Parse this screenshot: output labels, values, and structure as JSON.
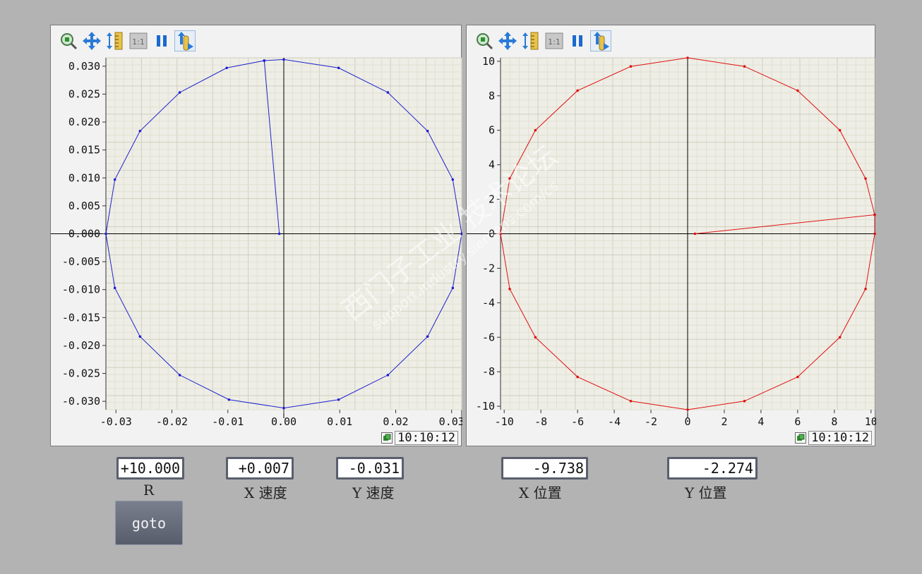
{
  "toolbar": {
    "icons": [
      "zoom-icon",
      "pan-icon",
      "ruler-icon",
      "zoom-1to1-icon",
      "pause-icon",
      "scroll-icon"
    ],
    "one_to_one_label": "1:1"
  },
  "left_chart": {
    "clock_time": "10:10:12",
    "y_tick_labels": [
      "0.030",
      "0.025",
      "0.020",
      "0.015",
      "0.010",
      "0.005",
      "0.000",
      "-0.005",
      "-0.010",
      "-0.015",
      "-0.020",
      "-0.025",
      "-0.030"
    ],
    "x_tick_labels": [
      "-0.03",
      "-0.02",
      "-0.01",
      "0.00",
      "0.01",
      "0.02",
      "0.03"
    ],
    "color": "#1f1fd0"
  },
  "right_chart": {
    "clock_time": "10:10:12",
    "y_tick_labels": [
      "10",
      "8",
      "6",
      "4",
      "2",
      "0",
      "-2",
      "-4",
      "-6",
      "-8",
      "-10"
    ],
    "x_tick_labels": [
      "-10",
      "-8",
      "-6",
      "-4",
      "-2",
      "0",
      "2",
      "4",
      "6",
      "8",
      "10"
    ],
    "color": "#e01010"
  },
  "chart_data": [
    {
      "type": "line",
      "title": "",
      "xlabel": "",
      "ylabel": "",
      "xlim": [
        -0.0318,
        0.0318
      ],
      "ylim": [
        -0.0315,
        0.0315
      ],
      "grid": true,
      "series": [
        {
          "x": [
            -0.0008,
            -0.0035,
            -0.0102,
            -0.0186,
            -0.0257,
            -0.0302,
            -0.0318,
            -0.0302,
            -0.0257,
            -0.0186,
            -0.0098,
            0.0,
            0.0098,
            0.0186,
            0.0257,
            0.0302,
            0.0318,
            0.0302,
            0.0257,
            0.0186,
            0.0098,
            0.0,
            -0.0035
          ],
          "y": [
            0.0,
            0.031,
            0.0297,
            0.0253,
            0.0184,
            0.0097,
            0.0,
            -0.0097,
            -0.0184,
            -0.0253,
            -0.0297,
            -0.0312,
            -0.0297,
            -0.0253,
            -0.0184,
            -0.0097,
            0.0,
            0.0097,
            0.0184,
            0.0253,
            0.0297,
            0.0312,
            0.031
          ]
        }
      ]
    },
    {
      "type": "line",
      "title": "",
      "xlabel": "",
      "ylabel": "",
      "xlim": [
        -10.2,
        10.2
      ],
      "ylim": [
        -10.2,
        10.2
      ],
      "grid": true,
      "series": [
        {
          "x": [
            0.4,
            10.2,
            9.7,
            8.3,
            6.0,
            3.1,
            0.0,
            -3.1,
            -6.0,
            -8.3,
            -9.7,
            -10.2,
            -9.7,
            -8.3,
            -6.0,
            -3.1,
            0.0,
            3.1,
            6.0,
            8.3,
            9.7,
            10.2,
            10.2
          ],
          "y": [
            0.0,
            1.1,
            3.2,
            6.0,
            8.3,
            9.7,
            10.2,
            9.7,
            8.3,
            6.0,
            3.2,
            0.0,
            -3.2,
            -6.0,
            -8.3,
            -9.7,
            -10.2,
            -9.7,
            -8.3,
            -6.0,
            -3.2,
            0.0,
            1.1
          ]
        }
      ]
    }
  ],
  "fields": {
    "r_value": "+10.000",
    "r_label": "R",
    "x_speed_value": "+0.007",
    "x_speed_label": "X 速度",
    "y_speed_value": "-0.031",
    "y_speed_label": "Y 速度",
    "x_pos_value": "-9.738",
    "x_pos_label": "X 位置",
    "y_pos_value": "-2.274",
    "y_pos_label": "Y 位置"
  },
  "goto_label": "goto",
  "watermark": {
    "line1": "西门子工业 技术论坛",
    "line2": "support.industry.siemens.com/cs"
  }
}
